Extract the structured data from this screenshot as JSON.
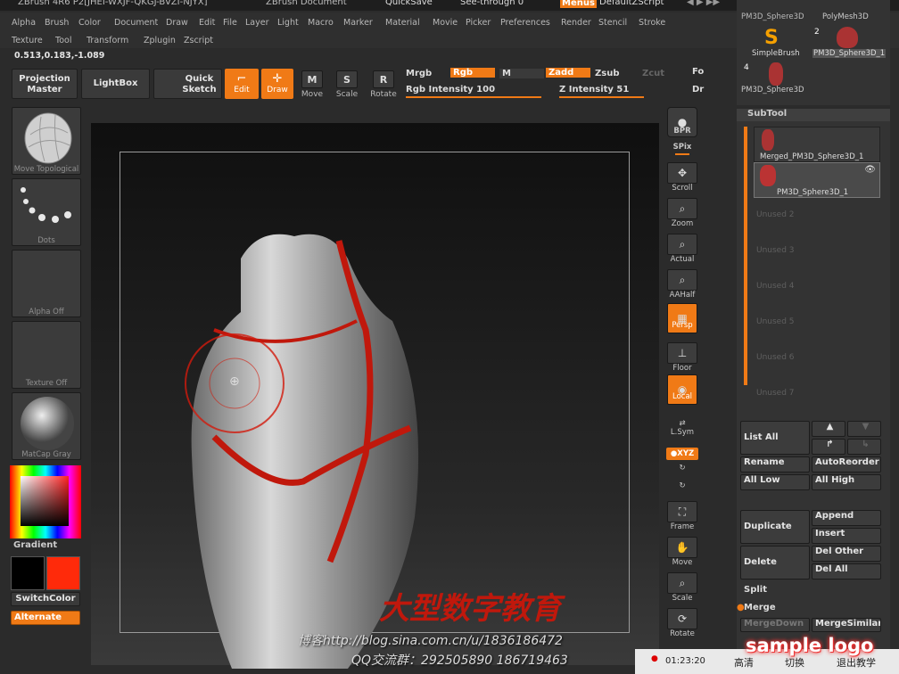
{
  "title": {
    "text": "ZBrush 4R6 P2[JHEI-WXJF-QKGJ-BVZI-NJYX]",
    "doc": "ZBrush Document",
    "quicksave": "QuickSave",
    "see_through": "See-through  0",
    "menus": "Menus",
    "default_zscript": "DefaultZScript"
  },
  "menus_row1": [
    "Alpha",
    "Brush",
    "Color",
    "Document",
    "Draw",
    "Edit",
    "File",
    "Layer",
    "Light",
    "Macro",
    "Marker",
    "Material",
    "Movie",
    "Picker",
    "Preferences",
    "Render",
    "Stencil",
    "Stroke"
  ],
  "menus_row2": [
    "Texture",
    "Tool",
    "Transform",
    "Zplugin",
    "Zscript"
  ],
  "coords": "0.513,0.183,-1.089",
  "toolbar": {
    "projection_master": "Projection Master",
    "lightbox": "LightBox",
    "quick_sketch": "Quick Sketch",
    "edit": "Edit",
    "draw": "Draw",
    "move": "Move",
    "scale": "Scale",
    "rotate": "Rotate",
    "mrgb": "Mrgb",
    "rgb": "Rgb",
    "m": "M",
    "zadd": "Zadd",
    "zsub": "Zsub",
    "zcut": "Zcut",
    "rgb_intensity": "Rgb Intensity 100",
    "z_intensity": "Z Intensity 51",
    "fo": "Fo",
    "dr": "Dr"
  },
  "left": {
    "topological": "Move Topological",
    "dots": "Dots",
    "alpha": "Alpha Off",
    "texture": "Texture Off",
    "matcap": "MatCap Gray",
    "gradient": "Gradient",
    "switchcolor": "SwitchColor",
    "alternate": "Alternate"
  },
  "right_shelf": {
    "bpr": "BPR",
    "spix": "SPix",
    "scroll": "Scroll",
    "zoom": "Zoom",
    "actual": "Actual",
    "aahalf": "AAHalf",
    "persp": "Persp",
    "floor": "Floor",
    "local": "Local",
    "lsym": "L.Sym",
    "xyz": "●XYZ",
    "frame": "Frame",
    "move": "Move",
    "scale": "Scale",
    "rotate": "Rotate"
  },
  "tools": {
    "t1": "PM3D_Sphere3D",
    "t2": "PolyMesh3D",
    "t3": "SimpleBrush",
    "t4": "PM3D_Sphere3D_1",
    "t5": "PM3D_Sphere3D",
    "num2": "2",
    "num4": "4"
  },
  "subtool": {
    "header": "SubTool",
    "item1": "Merged_PM3D_Sphere3D_1",
    "item2": "PM3D_Sphere3D_1",
    "unused": [
      "Unused 2",
      "Unused 3",
      "Unused 4",
      "Unused 5",
      "Unused 6",
      "Unused 7"
    ],
    "list_all": "List All",
    "rename": "Rename",
    "autoreorder": "AutoReorder",
    "all_low": "All Low",
    "all_high": "All High",
    "duplicate": "Duplicate",
    "append": "Append",
    "insert": "Insert",
    "delete": "Delete",
    "del_other": "Del Other",
    "del_all": "Del All",
    "split": "Split",
    "merge": "Merge",
    "mergedown": "MergeDown",
    "mergesimilar": "MergeSimilar"
  },
  "watermark": {
    "chinese": "大型数字教育",
    "blog": "博客http://blog.sina.com.cn/u/1836186472",
    "qq": "QQ交流群：292505890  186719463",
    "logo": "sample logo"
  },
  "player": {
    "time": "01:23:20",
    "quality": "高清",
    "switch": "切换",
    "exit": "退出教学"
  },
  "colors": {
    "accent": "#f07a16",
    "primary_color": "#000000",
    "secondary_color": "#ff2a0a"
  }
}
